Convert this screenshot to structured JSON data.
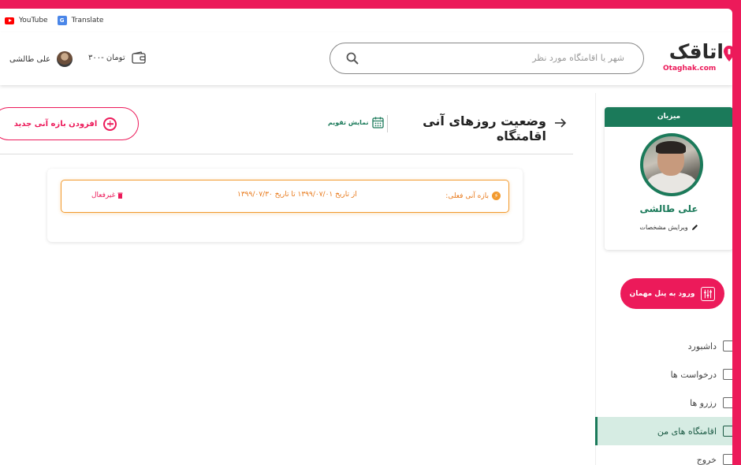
{
  "bookmarks": [
    {
      "label": "YouTube",
      "icon": "youtube-icon"
    },
    {
      "label": "Translate",
      "icon": "translate-icon"
    }
  ],
  "header": {
    "logo_text": "اتاقک",
    "logo_sub": "Otaghak.com",
    "search_placeholder": "شهر یا اقامتگاه مورد نظر",
    "user_name": "علی طالشی",
    "wallet_amount": "۳۰۰- تومان"
  },
  "main": {
    "page_title": "وضعیت روزهای آنی اقامتگاه",
    "calendar_link": "نمایش تقویم",
    "add_button": "افزودن بازه آنی جدید",
    "period": {
      "label": "بازه آنی فعلی:",
      "range": "از تاریخ ۱۳۹۹/۰۷/۰۱ تا تاریخ ۱۳۹۹/۰۷/۳۰",
      "status": "غیرفعال"
    }
  },
  "sidebar": {
    "host_label": "میزبان",
    "host_name": "علی طالشی",
    "edit_profile": "ویرایش مشخصات",
    "guest_panel_button": "ورود به پنل مهمان",
    "menu": [
      {
        "label": "داشبورد",
        "active": false
      },
      {
        "label": "درخواست ها",
        "active": false
      },
      {
        "label": "رزرو ها",
        "active": false
      },
      {
        "label": "اقامتگاه های من",
        "active": true
      },
      {
        "label": "خروج",
        "active": false
      }
    ]
  },
  "colors": {
    "brand": "#ec1a5a",
    "green": "#1b7a5a",
    "orange": "#f29a2e"
  }
}
